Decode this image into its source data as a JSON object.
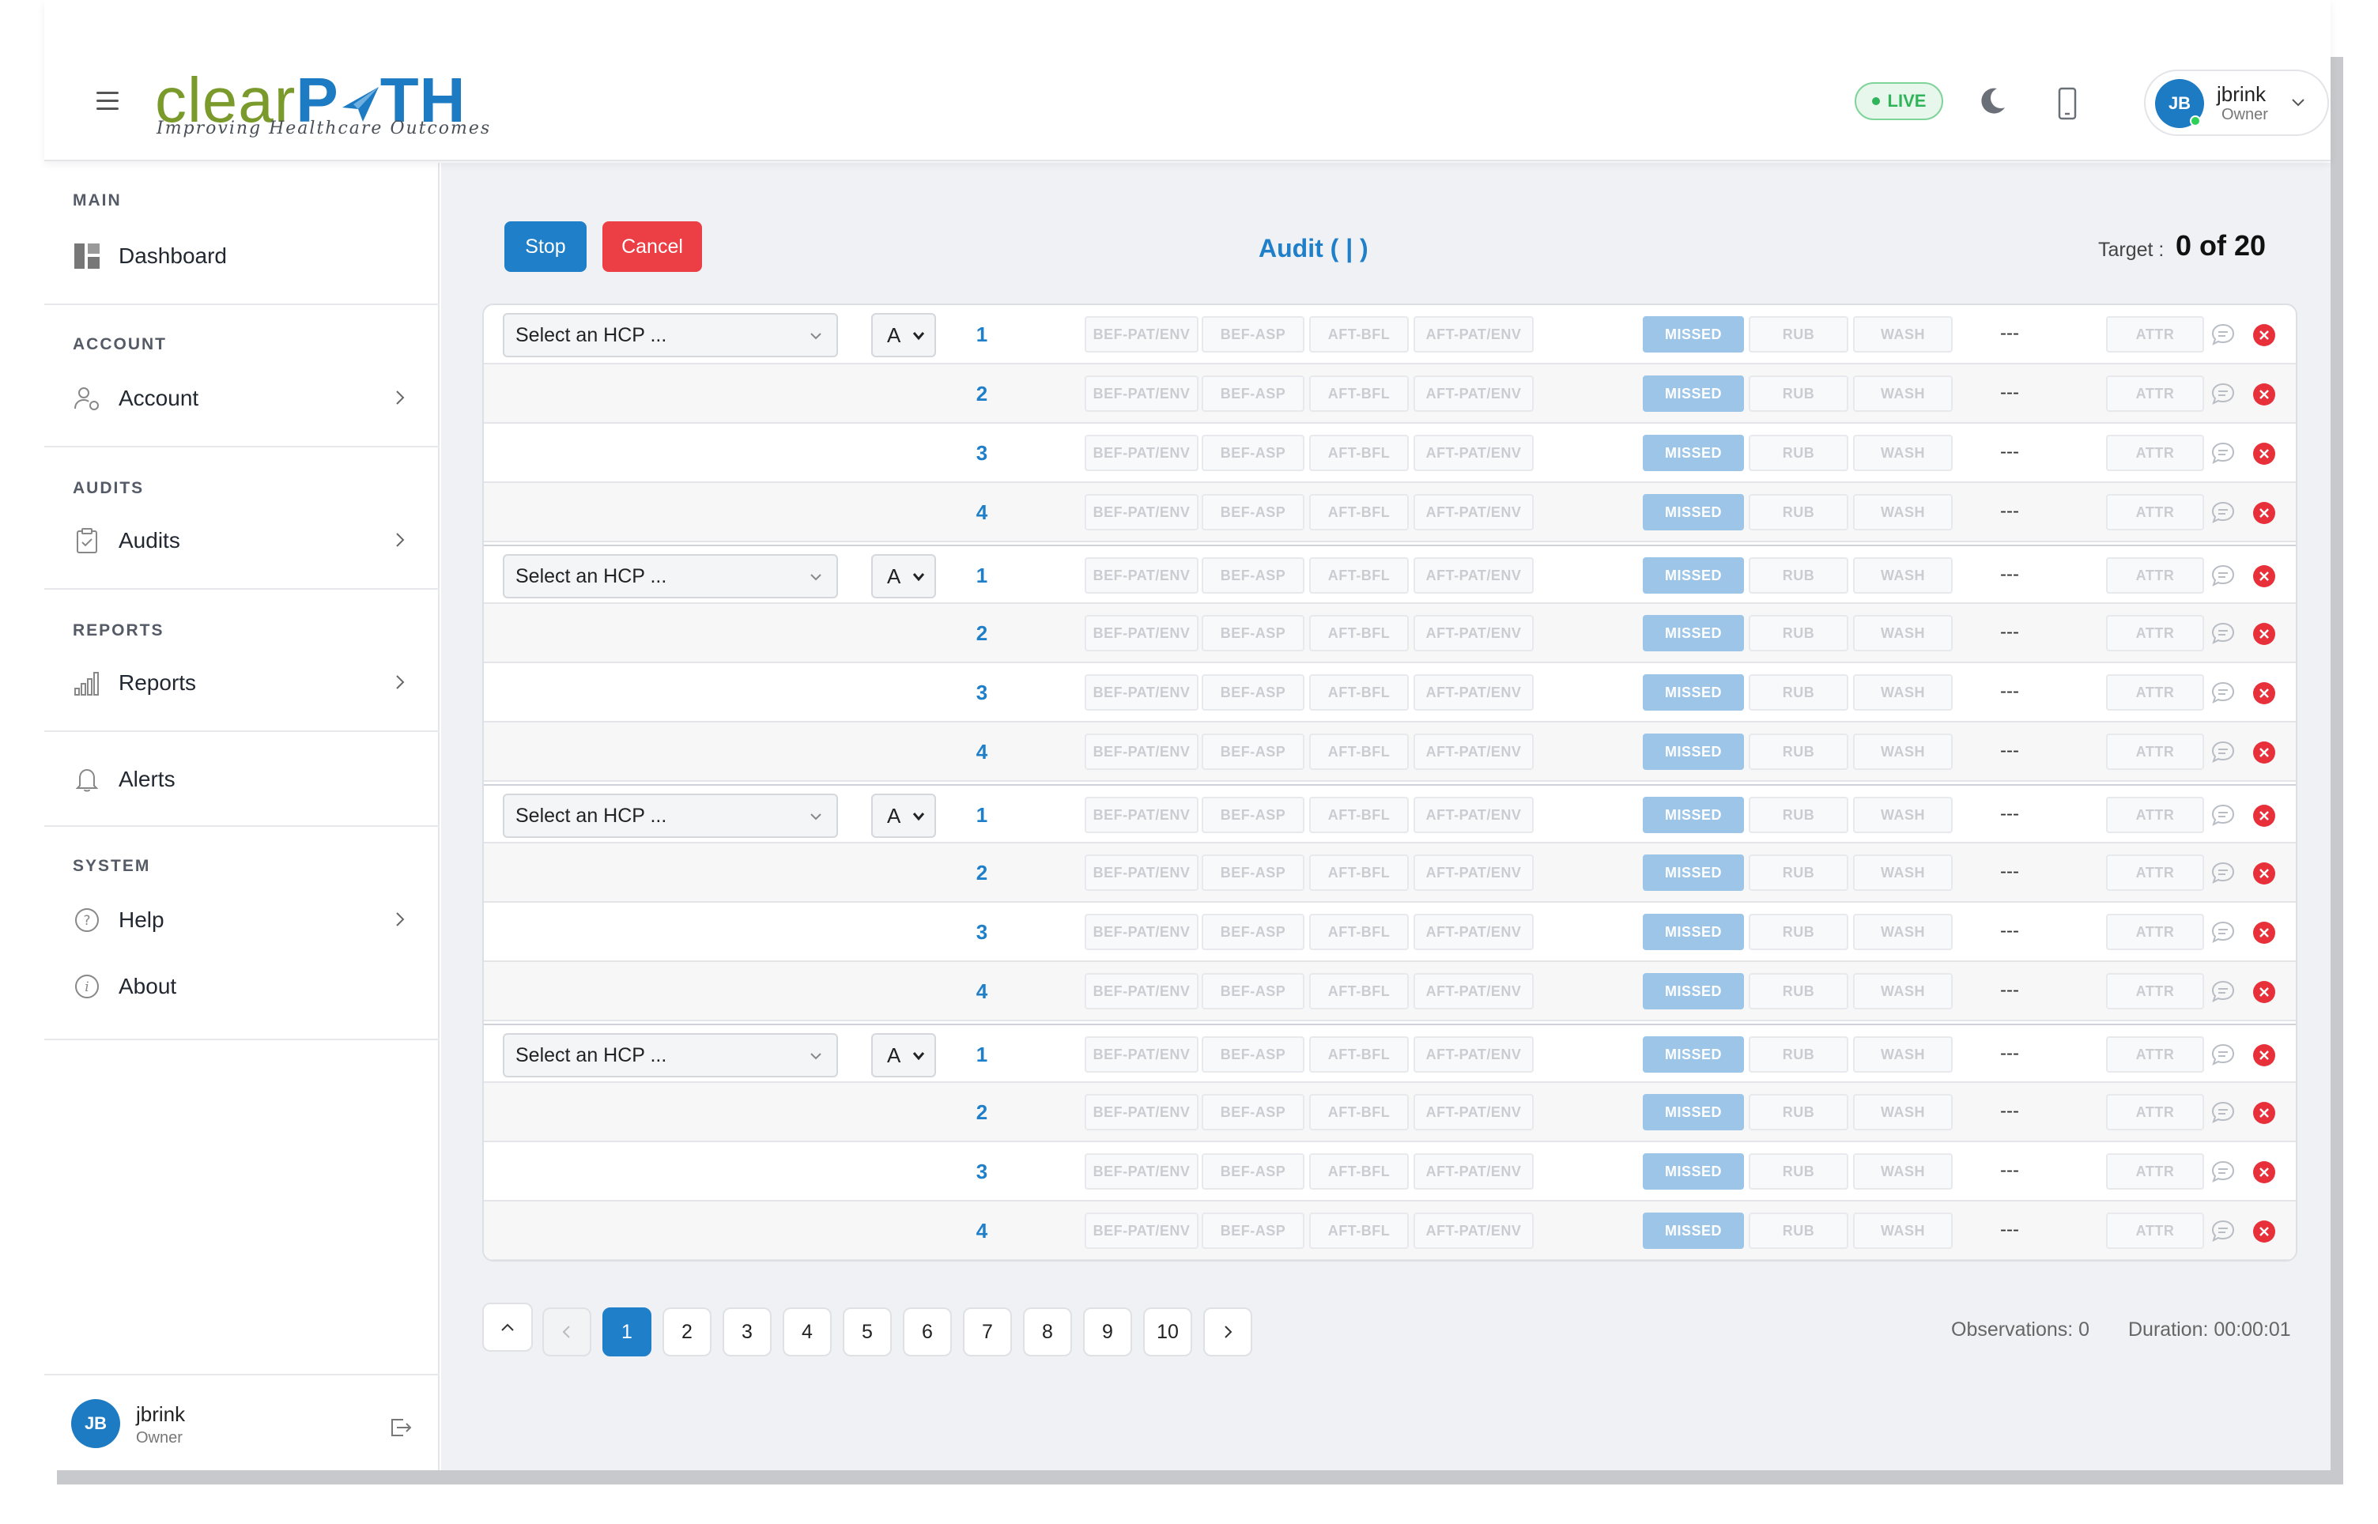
{
  "header": {
    "logo_text_a": "clear",
    "logo_text_b": "P",
    "logo_text_c": "TH",
    "logo_tagline": "Improving Healthcare Outcomes",
    "live_label": "LIVE",
    "user_name": "jbrink",
    "user_role": "Owner",
    "user_initials": "JB"
  },
  "sidebar": {
    "sections": [
      {
        "title": "MAIN",
        "items": [
          {
            "label": "Dashboard",
            "icon": "dashboard-icon",
            "chevron": false
          }
        ]
      },
      {
        "title": "ACCOUNT",
        "items": [
          {
            "label": "Account",
            "icon": "user-cog-icon",
            "chevron": true
          }
        ]
      },
      {
        "title": "AUDITS",
        "items": [
          {
            "label": "Audits",
            "icon": "clipboard-icon",
            "chevron": true
          }
        ]
      },
      {
        "title": "REPORTS",
        "items": [
          {
            "label": "Reports",
            "icon": "bar-chart-icon",
            "chevron": true
          }
        ]
      },
      {
        "title": "",
        "items": [
          {
            "label": "Alerts",
            "icon": "bell-icon",
            "chevron": false
          }
        ]
      },
      {
        "title": "SYSTEM",
        "items": [
          {
            "label": "Help",
            "icon": "help-icon",
            "chevron": true
          },
          {
            "label": "About",
            "icon": "info-icon",
            "chevron": false
          }
        ]
      }
    ],
    "footer": {
      "name": "jbrink",
      "role": "Owner",
      "initials": "JB"
    }
  },
  "toolbar": {
    "stop_label": "Stop",
    "cancel_label": "Cancel",
    "audit_title": "Audit ( | )",
    "target_label": "Target :",
    "target_value": "0 of 20"
  },
  "audit_table": {
    "hcp_placeholder": "Select an HCP ...",
    "group_letter": "A",
    "row_numbers": [
      "1",
      "2",
      "3",
      "4"
    ],
    "moment_chips": [
      "BEF-PAT/ENV",
      "BEF-ASP",
      "AFT-BFL",
      "AFT-PAT/ENV"
    ],
    "action_chips": [
      "MISSED",
      "RUB",
      "WASH"
    ],
    "time_placeholder": "---",
    "attr_label": "ATTR",
    "group_count": 4
  },
  "pagination": {
    "pages": [
      "1",
      "2",
      "3",
      "4",
      "5",
      "6",
      "7",
      "8",
      "9",
      "10"
    ],
    "active_page": "1"
  },
  "status": {
    "observations": "Observations: 0",
    "duration": "Duration: 00:00:01"
  },
  "colors": {
    "primary": "#1f7fc8",
    "danger": "#eb3f45",
    "live_green": "#2fb45a",
    "missed_chip": "#9cc5e8",
    "logo_green": "#7a9a2c"
  }
}
